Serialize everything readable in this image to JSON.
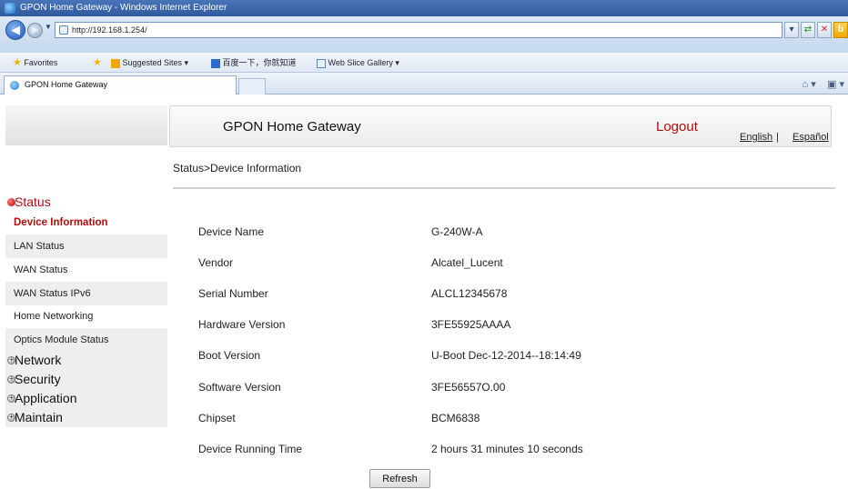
{
  "browser": {
    "window_title": "GPON Home Gateway - Windows Internet Explorer",
    "url": "http://192.168.1.254/",
    "favorites_bar": {
      "favorites_label": "Favorites",
      "suggested_sites_label": "Suggested Sites ▾",
      "baidu_label": "百度一下，你就知道",
      "web_slice_label": "Web Slice Gallery ▾"
    },
    "tab_title": "GPON Home Gateway"
  },
  "header": {
    "title": "GPON Home Gateway",
    "logout_label": "Logout",
    "lang_english": "English",
    "lang_separator": "|",
    "lang_spanish": "Español"
  },
  "breadcrumb": "Status>Device Information",
  "sidebar": {
    "status_label": "Status",
    "status_items": [
      {
        "label": "Device Information"
      },
      {
        "label": "LAN Status"
      },
      {
        "label": "WAN Status"
      },
      {
        "label": "WAN Status IPv6"
      },
      {
        "label": "Home Networking"
      },
      {
        "label": "Optics Module Status"
      }
    ],
    "groups": [
      {
        "label": "Network"
      },
      {
        "label": "Security"
      },
      {
        "label": "Application"
      },
      {
        "label": "Maintain"
      }
    ]
  },
  "device_info": [
    {
      "label": "Device Name",
      "value": "G-240W-A"
    },
    {
      "label": "Vendor",
      "value": "Alcatel_Lucent"
    },
    {
      "label": "Serial Number",
      "value": "ALCL12345678"
    },
    {
      "label": "Hardware Version",
      "value": "3FE55925AAAA"
    },
    {
      "label": "Boot Version",
      "value": "U-Boot Dec-12-2014--18:14:49"
    },
    {
      "label": "Software Version",
      "value": "3FE56557O.00"
    },
    {
      "label": "Chipset",
      "value": "BCM6838"
    },
    {
      "label": "Device Running Time",
      "value": "2 hours 31 minutes 10 seconds"
    }
  ],
  "refresh_label": "Refresh"
}
